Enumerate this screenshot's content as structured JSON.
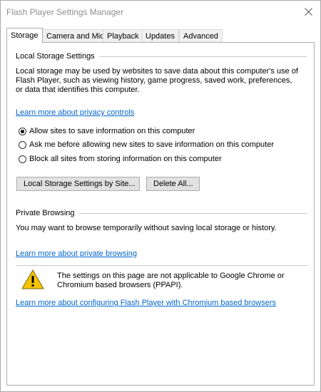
{
  "window": {
    "title": "Flash Player Settings Manager",
    "close_icon": "close-icon"
  },
  "tabs": [
    {
      "label": "Storage",
      "active": true
    },
    {
      "label": "Camera and Mic",
      "active": false
    },
    {
      "label": "Playback",
      "active": false
    },
    {
      "label": "Updates",
      "active": false
    },
    {
      "label": "Advanced",
      "active": false
    }
  ],
  "local_storage": {
    "heading": "Local Storage Settings",
    "description": "Local storage may be used by websites to save data about this computer's use of Flash Player, such as viewing history, game progress, saved work, preferences, or data that identifies this computer.",
    "privacy_link": "Learn more about privacy controls",
    "options": [
      {
        "label": "Allow sites to save information on this computer",
        "checked": true
      },
      {
        "label": "Ask me before allowing new sites to save information on this computer",
        "checked": false
      },
      {
        "label": "Block all sites from storing information on this computer",
        "checked": false
      }
    ],
    "settings_by_site_button": "Local Storage Settings by Site...",
    "delete_all_button": "Delete All..."
  },
  "private_browsing": {
    "heading": "Private Browsing",
    "description": "You may want to browse temporarily without saving local storage or history.",
    "link": "Learn more about private browsing"
  },
  "notice": {
    "icon": "warning-icon",
    "text": "The settings on this page are not applicable to Google Chrome or Chromium based browsers (PPAPI).",
    "link": "Learn more about configuring Flash Player with Chromium based browsers"
  }
}
